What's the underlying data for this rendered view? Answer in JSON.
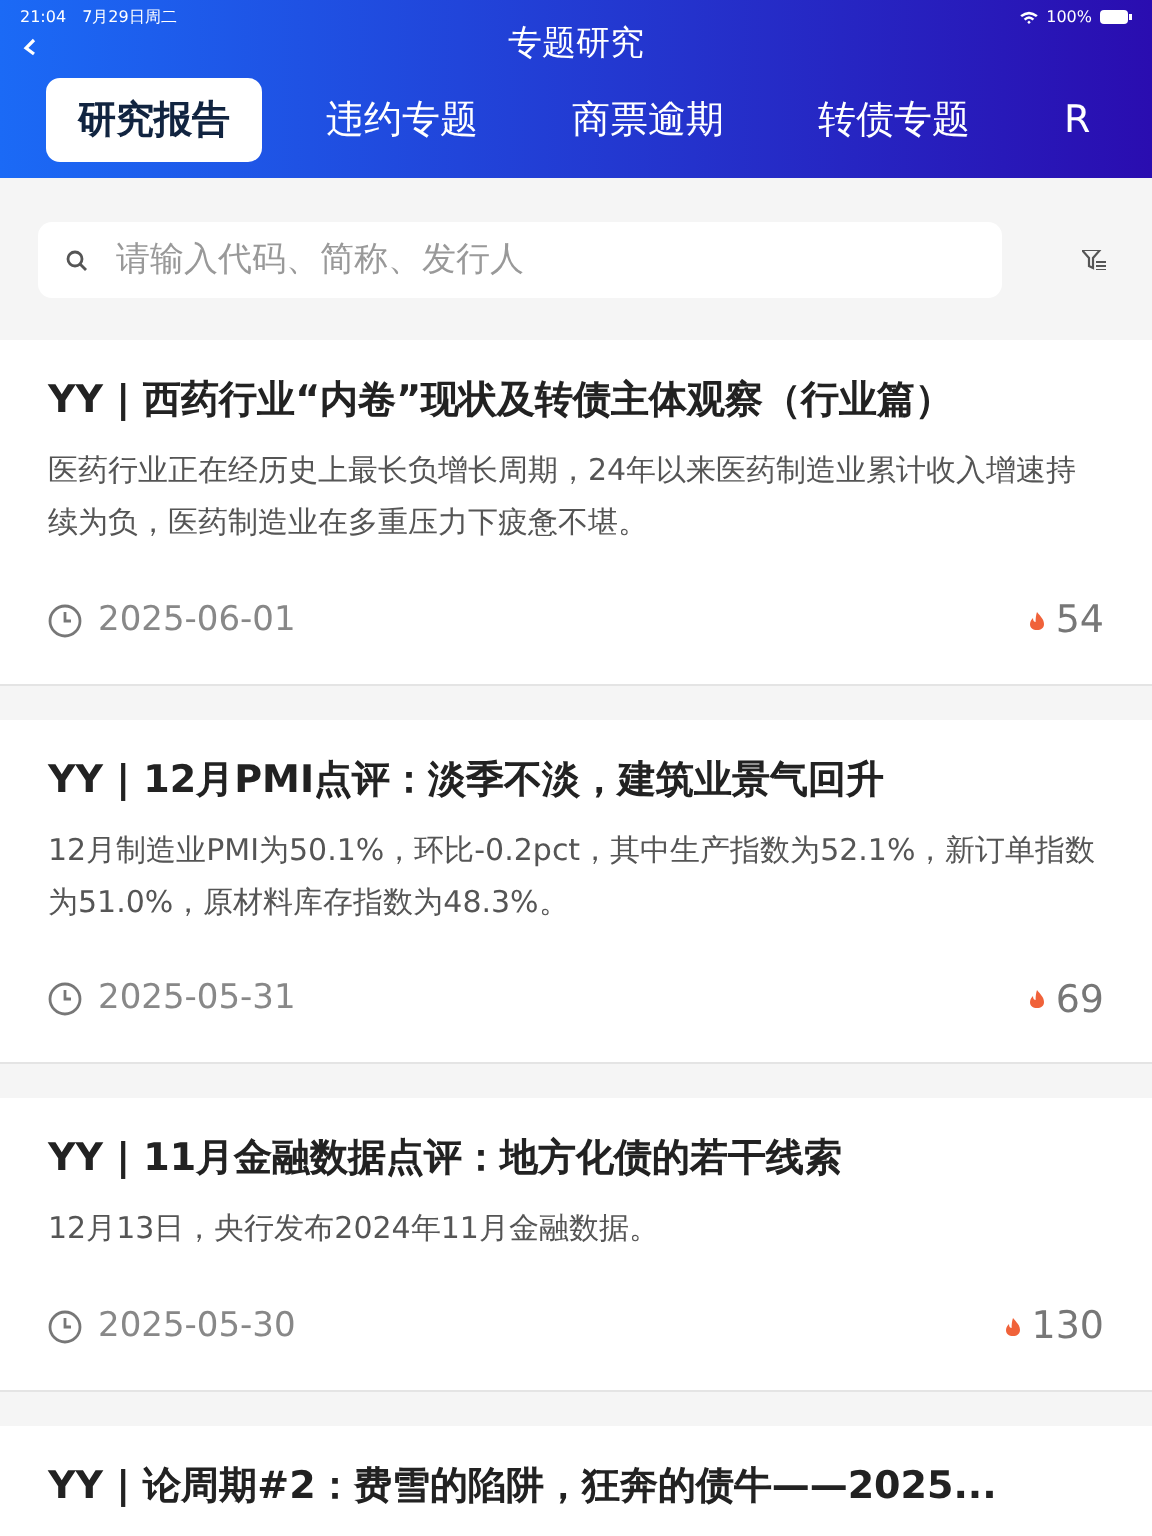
{
  "status_bar": {
    "time": "21:04",
    "date": "7月29日周二",
    "battery": "100%"
  },
  "title": "专题研究",
  "tabs": [
    {
      "label": "研究报告",
      "selected": true
    },
    {
      "label": "违约专题",
      "selected": false
    },
    {
      "label": "商票逾期",
      "selected": false
    },
    {
      "label": "转债专题",
      "selected": false
    },
    {
      "label": "R",
      "selected": false
    }
  ],
  "search": {
    "placeholder": "请输入代码、简称、发行人"
  },
  "articles": [
    {
      "title": "YY | 西药行业“内卷”现状及转债主体观察（行业篇）",
      "summary": "医药行业正在经历史上最长负增长周期，24年以来医药制造业累计收入增速持续为负，医药制造业在多重压力下疲惫不堪。",
      "date": "2025-06-01",
      "hot": "54"
    },
    {
      "title": "YY | 12月PMI点评：淡季不淡，建筑业景气回升",
      "summary": "12月制造业PMI为50.1%，环比-0.2pct，其中生产指数为52.1%，新订单指数为51.0%，原材料库存指数为48.3%。",
      "date": "2025-05-31",
      "hot": "69"
    },
    {
      "title": "YY |  11月金融数据点评：地方化债的若干线索",
      "summary": "12月13日，央行发布2024年11月金融数据。",
      "date": "2025-05-30",
      "hot": "130"
    },
    {
      "title": "YY | 论周期#2：费雪的陷阱，狂奔的债牛——2025..."
    }
  ]
}
